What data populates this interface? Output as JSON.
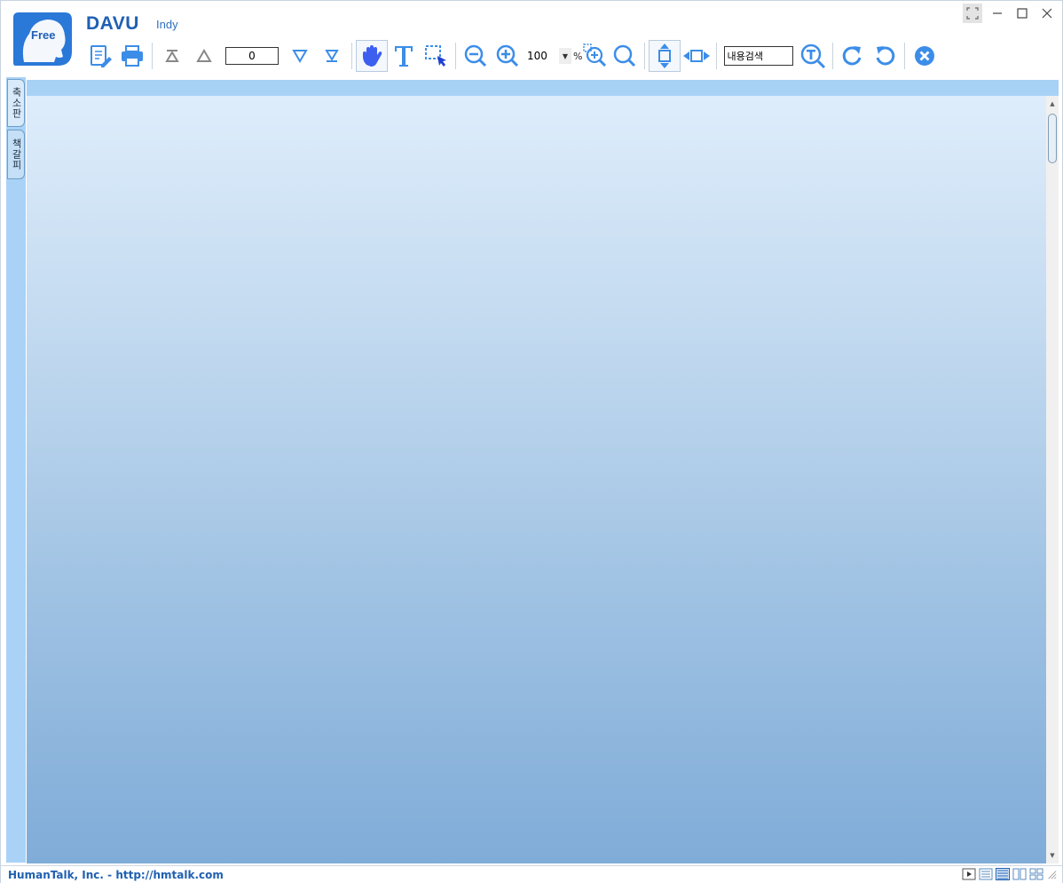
{
  "app": {
    "logo_text": "Free",
    "brand": "DAVU",
    "brand_sub": "Indy"
  },
  "window_controls": {
    "fullscreen_icon": "fullscreen-icon",
    "minimize_icon": "minimize-icon",
    "maximize_icon": "maximize-icon",
    "close_icon": "close-icon"
  },
  "toolbar": {
    "page_number": "0",
    "zoom_value": "100",
    "zoom_unit": "%",
    "search_value": "내용검색",
    "icons": [
      "edit-document-icon",
      "print-icon",
      "first-page-icon",
      "previous-page-icon",
      "next-page-icon",
      "last-page-icon",
      "hand-tool-icon",
      "text-select-icon",
      "area-select-icon",
      "zoom-out-icon",
      "zoom-in-icon",
      "zoom-area-icon",
      "zoom-fit-icon",
      "fit-height-icon",
      "fit-width-icon",
      "text-search-icon",
      "rotate-right-icon",
      "rotate-left-icon",
      "close-document-icon"
    ]
  },
  "side_tabs": {
    "thumbnails": "축소판",
    "bookmarks": "책갈피"
  },
  "status": {
    "text": "HumanTalk, Inc. - http://hmtalk.com",
    "icons": [
      "slideshow-icon",
      "single-page-icon",
      "continuous-page-icon",
      "two-page-icon",
      "two-page-continuous-icon"
    ]
  },
  "colors": {
    "brand": "#1e5fb4",
    "accent_blue": "#3c8de8",
    "side_strip": "#a9d2f6",
    "status_text": "#2060b0"
  }
}
